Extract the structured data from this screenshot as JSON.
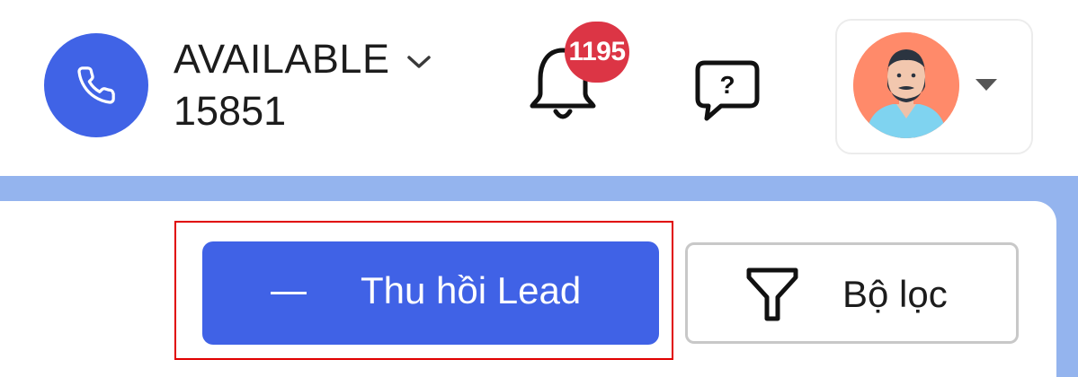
{
  "agent": {
    "status": "AVAILABLE",
    "extension": "15851",
    "phone_icon": "phone-icon",
    "status_caret_icon": "chevron-down-icon"
  },
  "notifications": {
    "icon": "bell-icon",
    "count": "1195",
    "badge_color": "#dc3545"
  },
  "help": {
    "icon": "help-chat-icon"
  },
  "profile": {
    "avatar": "user-avatar",
    "caret_icon": "caret-down-icon"
  },
  "toolbar": {
    "recall_label": "Thu hồi Lead",
    "recall_icon": "minus-icon",
    "filter_label": "Bộ lọc",
    "filter_icon": "funnel-icon"
  },
  "colors": {
    "accent": "#4062e6",
    "band": "#94b4ee",
    "highlight": "#e00000"
  }
}
